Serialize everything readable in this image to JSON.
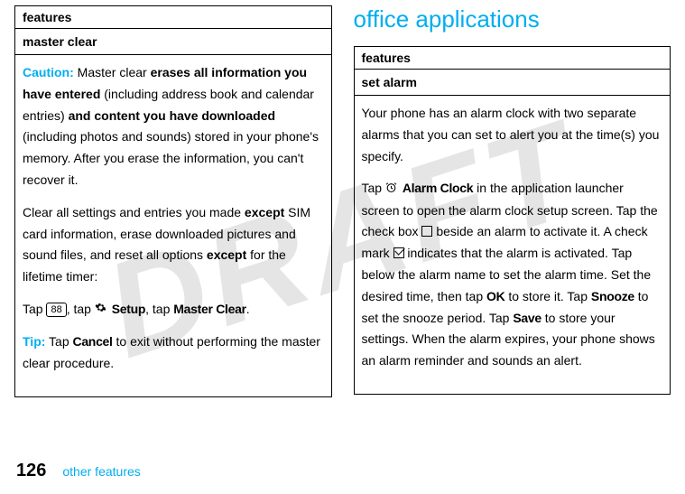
{
  "watermark": "DRAFT",
  "left": {
    "featuresHeader": "features",
    "subHeader": "master clear",
    "cautionLabel": "Caution:",
    "cautionP1a": " Master clear ",
    "cautionBold1": "erases all information you have entered",
    "cautionP1b": " (including address book and calendar entries) ",
    "cautionBold2": "and content you have downloaded",
    "cautionP1c": " (including photos and sounds) stored in your phone's memory. After you erase the information, you can't recover it.",
    "p2a": "Clear all settings and entries you made ",
    "p2bold1": "except",
    "p2b": " SIM card information, erase downloaded pictures and sound files, and reset all options ",
    "p2bold2": "except",
    "p2c": " for the lifetime timer:",
    "p3a": "Tap ",
    "key88": "88",
    "p3b": ", tap ",
    "setupLabel": "Setup",
    "p3c": ", tap ",
    "masterClearLabel": "Master Clear",
    "p3d": ".",
    "tipLabel": "Tip:",
    "tipA": " Tap ",
    "cancelLabel": "Cancel",
    "tipB": " to exit without performing the master clear procedure."
  },
  "right": {
    "sectionTitle": "office applications",
    "featuresHeader": "features",
    "subHeader": "set alarm",
    "p1": "Your phone has an alarm clock with two separate alarms that you can set to alert you at the time(s) you specify.",
    "p2a": "Tap ",
    "alarmClockLabel": "Alarm Clock",
    "p2b": " in the application launcher screen to open the alarm clock setup screen. Tap the check box ",
    "p2c": " beside an alarm to activate it. A check mark ",
    "p2d": " indicates that the alarm is activated. Tap below the alarm name to set the alarm time. Set the desired time, then tap ",
    "okLabel": "OK",
    "p2e": " to store it. Tap ",
    "snoozeLabel": "Snooze",
    "p2f": " to set the snooze period. Tap ",
    "saveLabel": "Save",
    "p2g": " to store your settings. When the alarm expires, your phone shows an alarm reminder and sounds an alert."
  },
  "footer": {
    "pageNumber": "126",
    "text": "other features"
  }
}
